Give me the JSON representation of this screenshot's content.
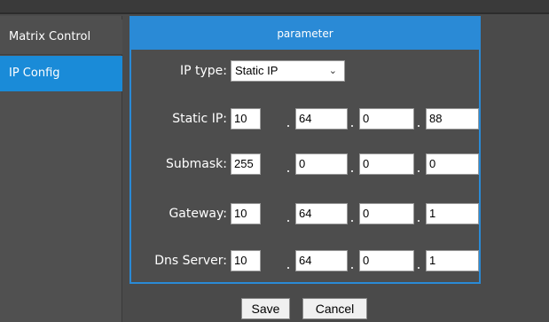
{
  "sidebar": {
    "items": [
      {
        "label": "Matrix Control",
        "active": false
      },
      {
        "label": "IP Config",
        "active": true
      }
    ]
  },
  "panel": {
    "title": "parameter",
    "ip_type": {
      "label": "IP type:",
      "value": "Static IP",
      "options_visible": [
        "Static IP"
      ]
    },
    "static_ip": {
      "label": "Static IP:",
      "octets": [
        "10",
        "64",
        "0",
        "88"
      ]
    },
    "submask": {
      "label": "Submask:",
      "octets": [
        "255",
        "0",
        "0",
        "0"
      ]
    },
    "gateway": {
      "label": "Gateway:",
      "octets": [
        "10",
        "64",
        "0",
        "1"
      ]
    },
    "dns_server": {
      "label": "Dns Server:",
      "octets": [
        "10",
        "64",
        "0",
        "1"
      ]
    }
  },
  "actions": {
    "save_label": "Save",
    "cancel_label": "Cancel"
  },
  "colors": {
    "accent": "#2a8ad6",
    "sidebar_active": "#1a8bd8",
    "background": "#4a4a4a"
  }
}
